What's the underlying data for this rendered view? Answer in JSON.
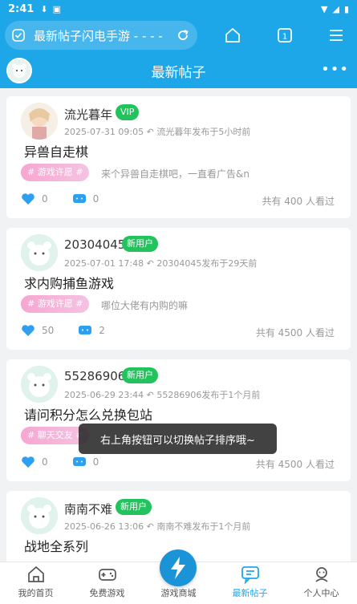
{
  "status_bar": {
    "time": "2:41"
  },
  "browser": {
    "url_title": "最新帖子闪电手游 - - - -",
    "tab_count": "1"
  },
  "header": {
    "title": "最新帖子"
  },
  "posts": [
    {
      "name": "流光暮年",
      "badge": "VIP",
      "date": "2025-07-31 09:05",
      "relative": "流光暮年发布于5小时前",
      "title": "异兽自走棋",
      "tag": "# 游戏许愿 #",
      "excerpt": "来个异兽自走棋吧，一直看广告&n",
      "likes": "0",
      "comments": "0",
      "views": "共有 400 人看过"
    },
    {
      "name": "20304045",
      "badge": "新用户",
      "date": "2025-07-01 17:48",
      "relative": "20304045发布于29天前",
      "title": "求内购捕鱼游戏",
      "tag": "# 游戏许愿 #",
      "excerpt": "哪位大佬有内购的嘛",
      "likes": "50",
      "comments": "2",
      "views": "共有 4500 人看过"
    },
    {
      "name": "55286906",
      "badge": "新用户",
      "date": "2025-06-29 23:44",
      "relative": "55286906发布于1个月前",
      "title": "请问积分怎么兑换包站",
      "tag": "# 聊天交友 #",
      "excerpt": "",
      "likes": "0",
      "comments": "0",
      "views": "共有 4500 人看过"
    },
    {
      "name": "南南不难",
      "badge": "新用户",
      "date": "2025-06-26 13:06",
      "relative": "南南不难发布于1个月前",
      "title": "战地全系列",
      "tag": "",
      "excerpt": "",
      "likes": "",
      "comments": "",
      "views": ""
    }
  ],
  "toast": "右上角按钮可以切换帖子排序哦~",
  "tabs": [
    {
      "label": "我的首页"
    },
    {
      "label": "免费游戏"
    },
    {
      "label": "游戏商城"
    },
    {
      "label": "最新帖子"
    },
    {
      "label": "个人中心"
    }
  ],
  "colors": {
    "accent": "#1ea7e8",
    "badge_green": "#22c25c",
    "tag_pink": "#f7a6d1"
  }
}
